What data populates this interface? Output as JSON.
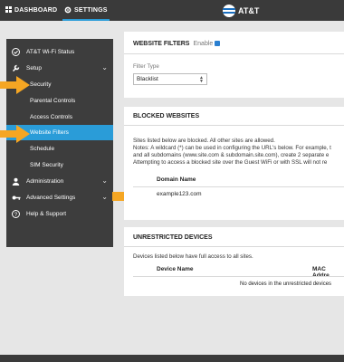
{
  "topbar": {
    "dashboard_label": "DASHBOARD",
    "settings_label": "SETTINGS",
    "brand": "AT&T"
  },
  "sidebar": {
    "items": [
      {
        "label": "AT&T Wi-Fi Status",
        "icon": "check-circle-icon"
      },
      {
        "label": "Setup",
        "icon": "wrench-icon"
      },
      {
        "label": "Security"
      },
      {
        "label": "Parental Controls"
      },
      {
        "label": "Access Controls"
      },
      {
        "label": "Website Filters"
      },
      {
        "label": "Schedule"
      },
      {
        "label": "SIM Security"
      },
      {
        "label": "Administration",
        "icon": "user-icon"
      },
      {
        "label": "Advanced Settings",
        "icon": "key-icon"
      },
      {
        "label": "Help & Support",
        "icon": "question-circle-icon"
      }
    ]
  },
  "website_filters": {
    "title": "WEBSITE FILTERS",
    "enable_label": "Enable",
    "filter_type_label": "Filter Type",
    "filter_type_value": "Blacklist"
  },
  "blocked_websites": {
    "title": "BLOCKED WEBSITES",
    "line1": "Sites listed below are blocked. All other sites are allowed.",
    "line2": "Notes: A wildcard (*) can be used in configuring the URL's below. For example, t",
    "line3": "and all subdomains (www.site.com & subdomain.site.com), create 2 separate e",
    "line4": "Attempting to access a blocked site over the Guest WiFi or with SSL will not re",
    "column_header": "Domain Name",
    "rows": [
      "example123.com"
    ]
  },
  "unrestricted_devices": {
    "title": "UNRESTRICTED DEVICES",
    "description": "Devices listed below have full access to all sites.",
    "col_device": "Device Name",
    "col_mac": "MAC Addre",
    "empty_message": "No devices in the unrestricted devices"
  },
  "colors": {
    "accent": "#2a9cd8",
    "arrow": "#f5a623",
    "sidebar_bg": "#3d3d3d",
    "topbar_bg": "#3a3a3a"
  }
}
